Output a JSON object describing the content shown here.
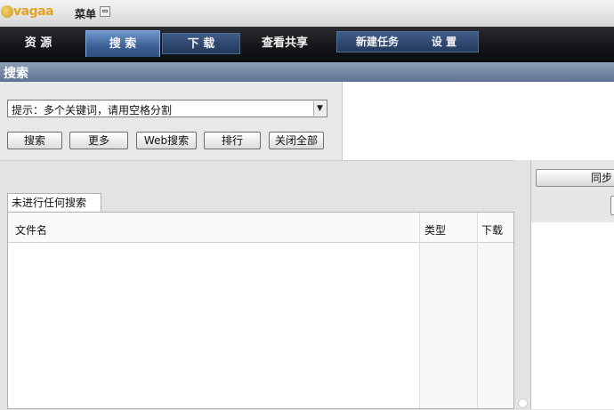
{
  "app": {
    "logo_text": "vagaa",
    "menu_label": "菜单"
  },
  "tabs": [
    {
      "label": "资 源"
    },
    {
      "label": "搜 索"
    },
    {
      "label": "下 载"
    },
    {
      "label": "查看共享"
    },
    {
      "label": "新建任务"
    },
    {
      "label": "设 置"
    }
  ],
  "section": {
    "title": "搜索"
  },
  "search": {
    "value": "提示：多个关键词，请用空格分割",
    "buttons": [
      "搜索",
      "更多",
      "Web搜索",
      "排行",
      "关闭全部"
    ]
  },
  "results": {
    "tab_label": "未进行任何搜索",
    "columns": [
      "文件名",
      "类型",
      "下载"
    ]
  },
  "right_panel": {
    "button_label": "同步"
  }
}
